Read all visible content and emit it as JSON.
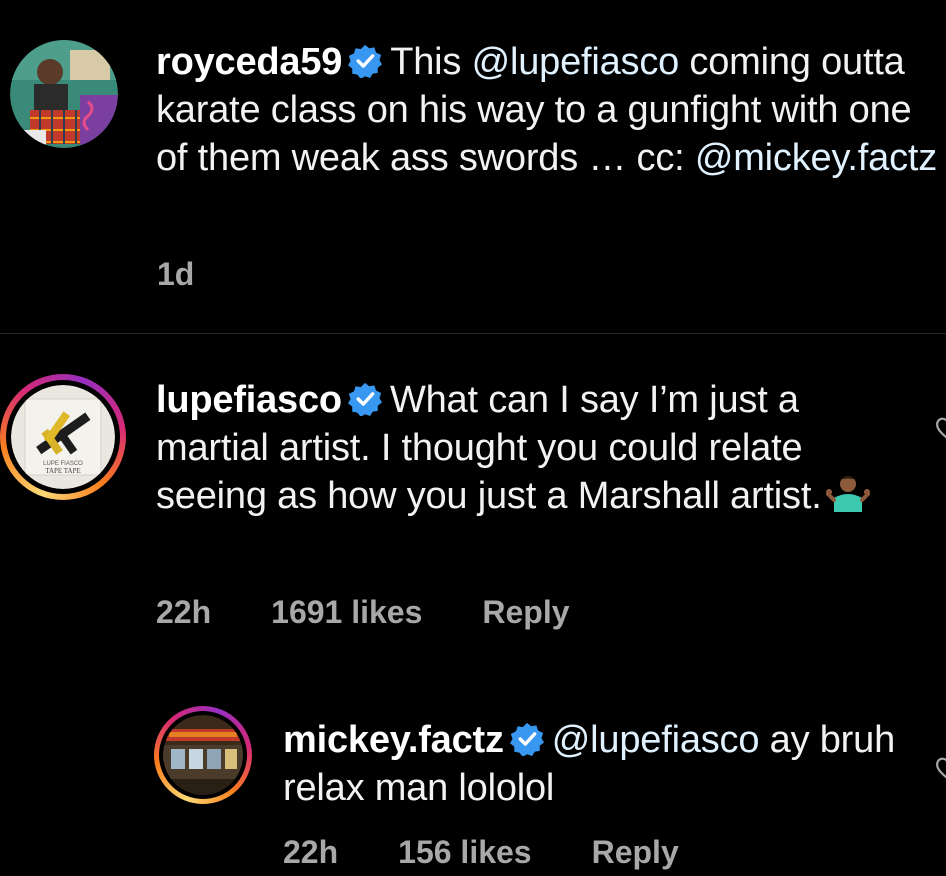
{
  "comments": [
    {
      "username": "royceda59",
      "text_before": "This ",
      "mention": "@lupefiasco",
      "text_after": " coming outta karate class on his way to a gunfight with one of them weak ass swords … cc: ",
      "mention2": "@mickey.factz",
      "time": "1d"
    },
    {
      "username": "lupefiasco",
      "text": "What can I say I’m just a martial artist. I thought you could relate seeing as how you just a Marshall artist.",
      "emoji": "person-shrugging",
      "avatar_label_1": "LUPE FIASCO",
      "avatar_label_2": "TAPE TAPE",
      "time": "22h",
      "likes": "1691 likes",
      "reply": "Reply"
    },
    {
      "username": "mickey.factz",
      "mention": "@lupefiasco",
      "text": " ay bruh relax man lololol",
      "time": "22h",
      "likes": "156 likes",
      "reply": "Reply"
    }
  ],
  "colors": {
    "background": "#000000",
    "verified": "#3897f0",
    "meta": "#a8a8a8",
    "mention": "#e0f1ff"
  }
}
